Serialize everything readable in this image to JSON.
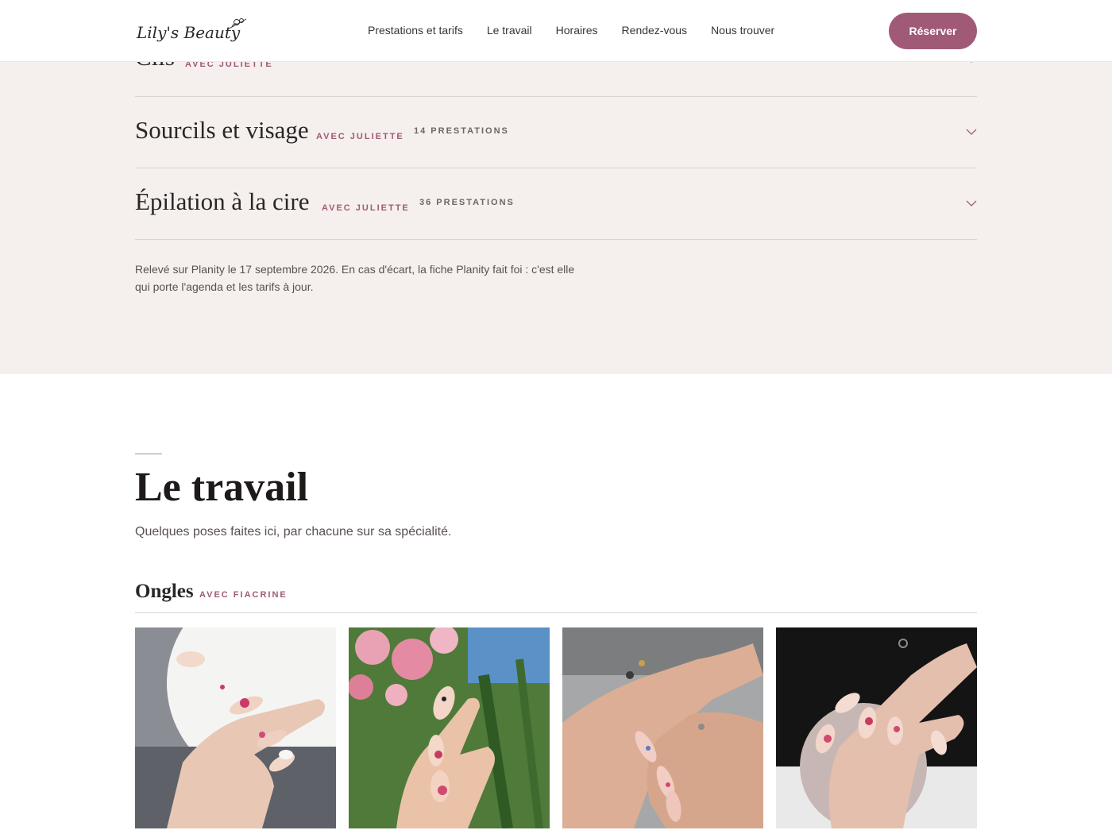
{
  "brand": {
    "logo_text": "Lily's Beauty"
  },
  "nav": {
    "items": [
      "Prestations et tarifs",
      "Le travail",
      "Horaires",
      "Rendez-vous",
      "Nous trouver"
    ],
    "cta": "Réserver"
  },
  "services": {
    "rows": [
      {
        "title": "Cils",
        "avec": "AVEC JULIETTE",
        "count": ""
      },
      {
        "title": "Sourcils et visage",
        "avec": "AVEC JULIETTE",
        "count": "14 PRESTATIONS"
      },
      {
        "title": "Épilation à la cire",
        "avec": "AVEC JULIETTE",
        "count": "36 PRESTATIONS"
      }
    ],
    "note": "Relevé sur Planity le 17 septembre 2026. En cas d'écart, la fiche Planity fait foi : c'est elle qui porte l'agenda et les tarifs à jour."
  },
  "work": {
    "title": "Le travail",
    "subtitle": "Quelques poses faites ici, par chacune sur sa spécialité.",
    "category": {
      "title": "Ongles",
      "avec": "AVEC FIACRINE"
    },
    "photos": [
      "nail-photo-white-french-floral",
      "nail-photo-pink-flowers",
      "nail-photo-hands-crossed-rings",
      "nail-photo-hand-on-ball"
    ]
  },
  "colors": {
    "accent": "#a05a78",
    "band": "#f5f0ed"
  }
}
